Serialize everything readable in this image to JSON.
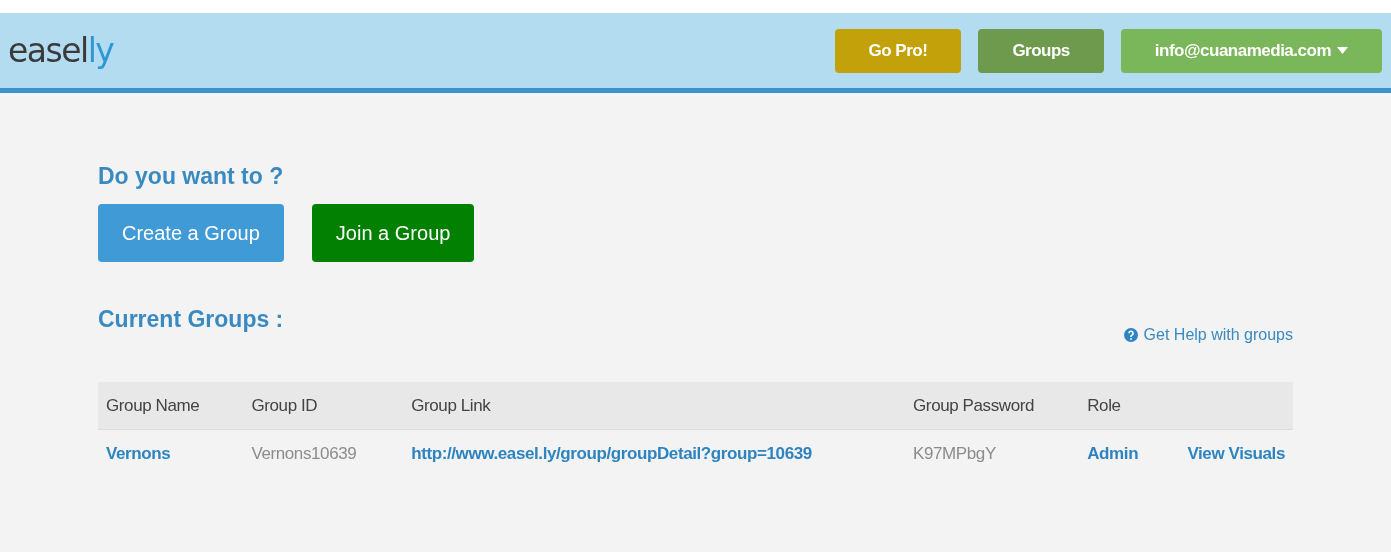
{
  "header": {
    "logo": [
      "easel",
      "ly"
    ],
    "buttons": [
      {
        "label": "Go Pro!",
        "kind": "pro"
      },
      {
        "label": "Groups",
        "kind": "groups"
      },
      {
        "label": "info@cuanamedia.com",
        "kind": "account"
      }
    ]
  },
  "prompt": {
    "title": "Do you want to ?",
    "buttons": [
      {
        "label": "Create a Group",
        "kind": "create"
      },
      {
        "label": "Join a Group",
        "kind": "join"
      }
    ]
  },
  "groups": {
    "title": "Current Groups :",
    "help_link": "Get Help with groups",
    "table": {
      "columns": [
        "Group Name",
        "Group ID",
        "Group Link",
        "Group Password",
        "Role",
        ""
      ],
      "rows": [
        [
          {
            "text": "Vernons",
            "kind": "link"
          },
          {
            "text": "Vernons10639",
            "kind": "text"
          },
          {
            "text": "http://www.easel.ly/group/groupDetail?group=10639",
            "kind": "link"
          },
          {
            "text": "K97MPbgY",
            "kind": "text"
          },
          {
            "text": "Admin",
            "kind": "link"
          },
          {
            "text": "View Visuals",
            "kind": "link"
          }
        ]
      ]
    }
  }
}
